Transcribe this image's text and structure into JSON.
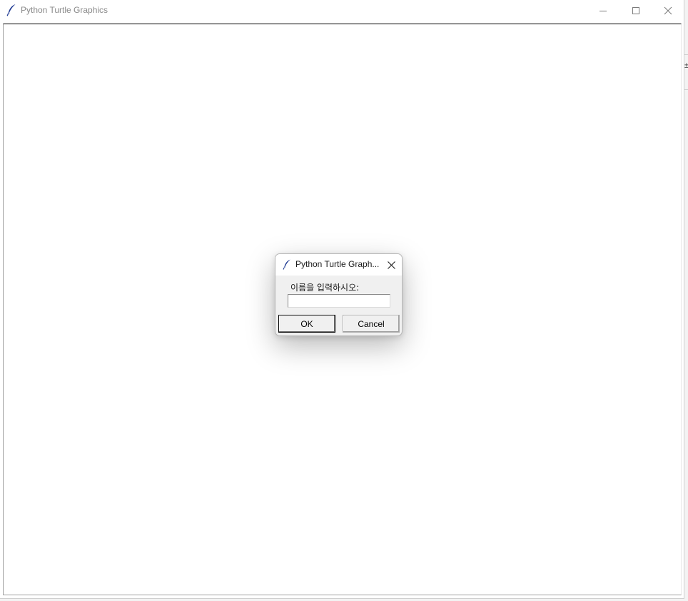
{
  "window": {
    "title": "Python Turtle Graphics",
    "minimize_icon": "minimize-icon",
    "maximize_icon": "maximize-icon",
    "close_icon": "close-icon",
    "app_icon": "feather-icon"
  },
  "dialog": {
    "title": "Python Turtle Graph...",
    "prompt": "이름을 입력하시오:",
    "input_value": "",
    "ok_label": "OK",
    "cancel_label": "Cancel",
    "close_icon": "close-icon"
  },
  "edge": {
    "glyph": "±"
  },
  "colors": {
    "window_bg": "#ffffff",
    "dialog_bg": "#f0f0f0",
    "title_text_inactive": "#8a8a8a",
    "feather_blue": "#1f3a93"
  }
}
